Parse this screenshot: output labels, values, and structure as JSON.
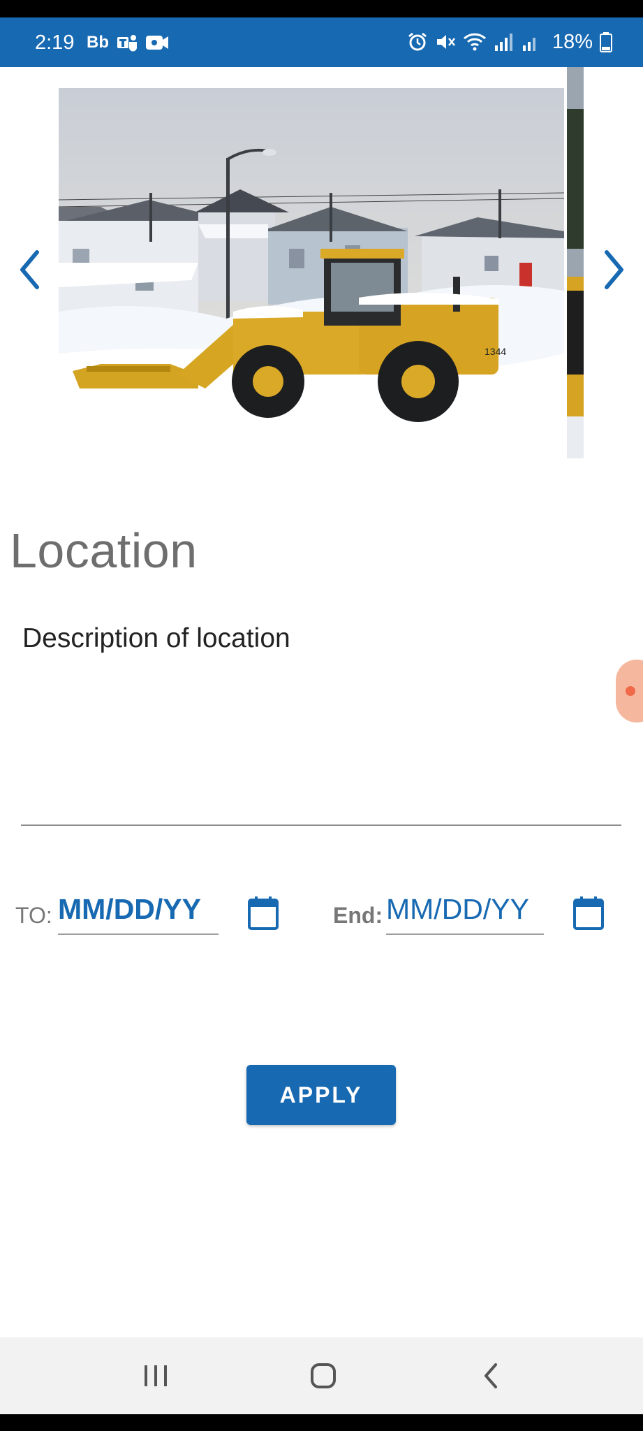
{
  "status_bar": {
    "time": "2:19",
    "carrier_badge": "Bb",
    "battery_percent": "18%",
    "icons": [
      "teams-icon",
      "video-icon",
      "alarm-icon",
      "mute-icon",
      "wifi-icon",
      "signal-icon",
      "signal-2-icon",
      "battery-icon"
    ]
  },
  "carousel": {
    "prev_icon": "chevron-left-icon",
    "next_icon": "chevron-right-icon",
    "accent_color": "#1769b2"
  },
  "location": {
    "title": "Location",
    "description_placeholder": "Description of location"
  },
  "dates": {
    "to_label": "TO:",
    "to_value": "MM/DD/YY",
    "end_label": "End:",
    "end_value": "MM/DD/YY"
  },
  "apply_label": "APPLY",
  "nav": {
    "icons": [
      "recent-apps-icon",
      "home-icon",
      "back-icon"
    ]
  },
  "colors": {
    "primary": "#1769b2",
    "title_gray": "#6e6e6e"
  }
}
